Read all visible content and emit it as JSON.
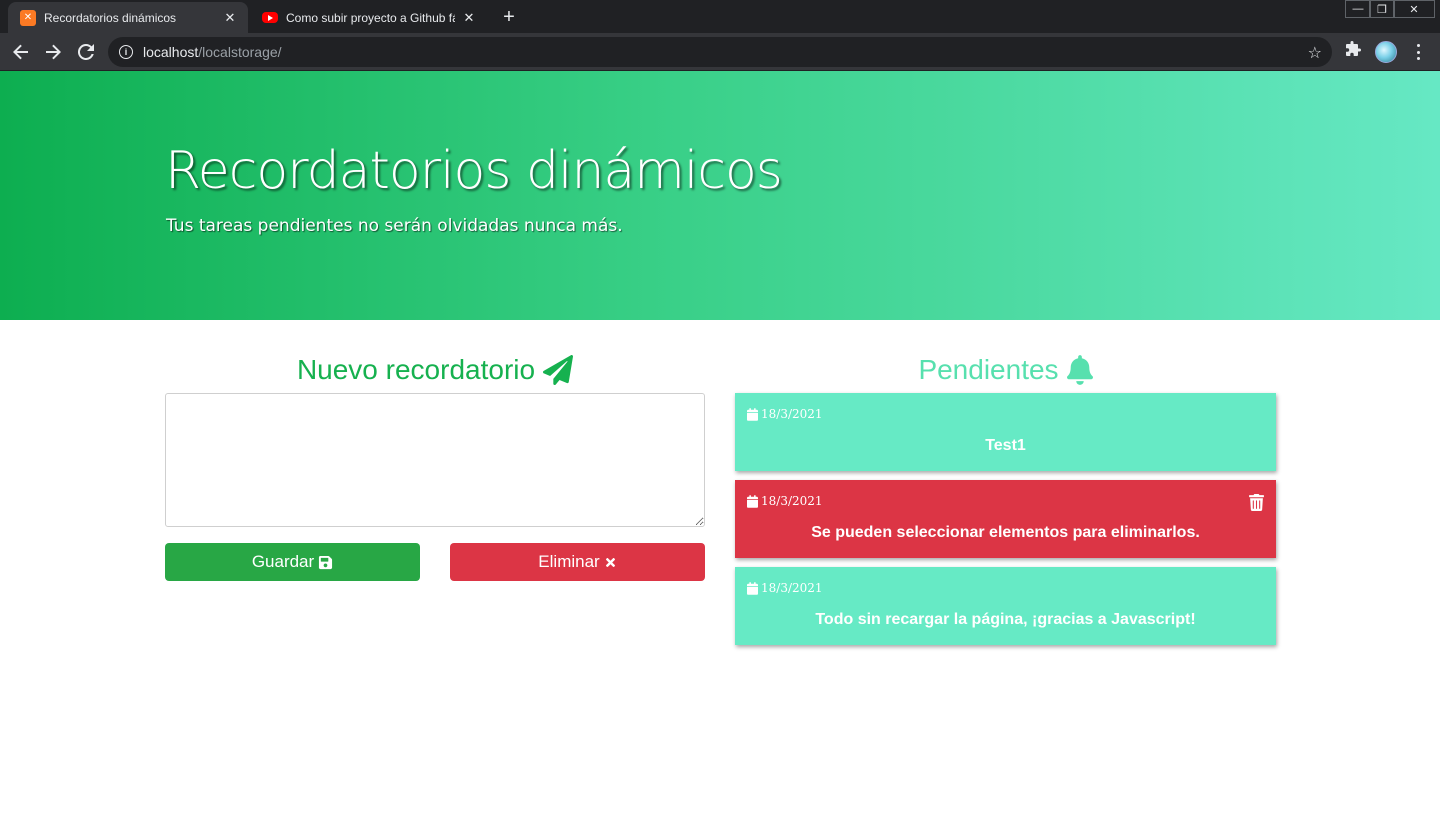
{
  "browser": {
    "tabs": [
      {
        "title": "Recordatorios dinámicos",
        "active": true,
        "favicon": "xampp-icon"
      },
      {
        "title": "Como subir proyecto a Github fá",
        "active": false,
        "favicon": "youtube-icon"
      }
    ],
    "url_host": "localhost",
    "url_path": "/localstorage/"
  },
  "hero": {
    "title": "Recordatorios dinámicos",
    "subtitle": "Tus tareas pendientes no serán olvidadas nunca más."
  },
  "form": {
    "title": "Nuevo recordatorio",
    "textarea_value": "",
    "save_label": "Guardar",
    "delete_label": "Eliminar"
  },
  "pending": {
    "title": "Pendientes",
    "items": [
      {
        "date": "18/3/2021",
        "text": "Test1",
        "selected": false
      },
      {
        "date": "18/3/2021",
        "text": "Se pueden seleccionar elementos para eliminarlos.",
        "selected": true
      },
      {
        "date": "18/3/2021",
        "text": "Todo sin recargar la página, ¡gracias a Javascript!",
        "selected": false
      }
    ]
  },
  "colors": {
    "hero_gradient_start": "#0dae50",
    "hero_gradient_end": "#66e8c4",
    "primary_green": "#16b14f",
    "mint": "#66eac5",
    "danger": "#dc3545",
    "success": "#28a745"
  }
}
